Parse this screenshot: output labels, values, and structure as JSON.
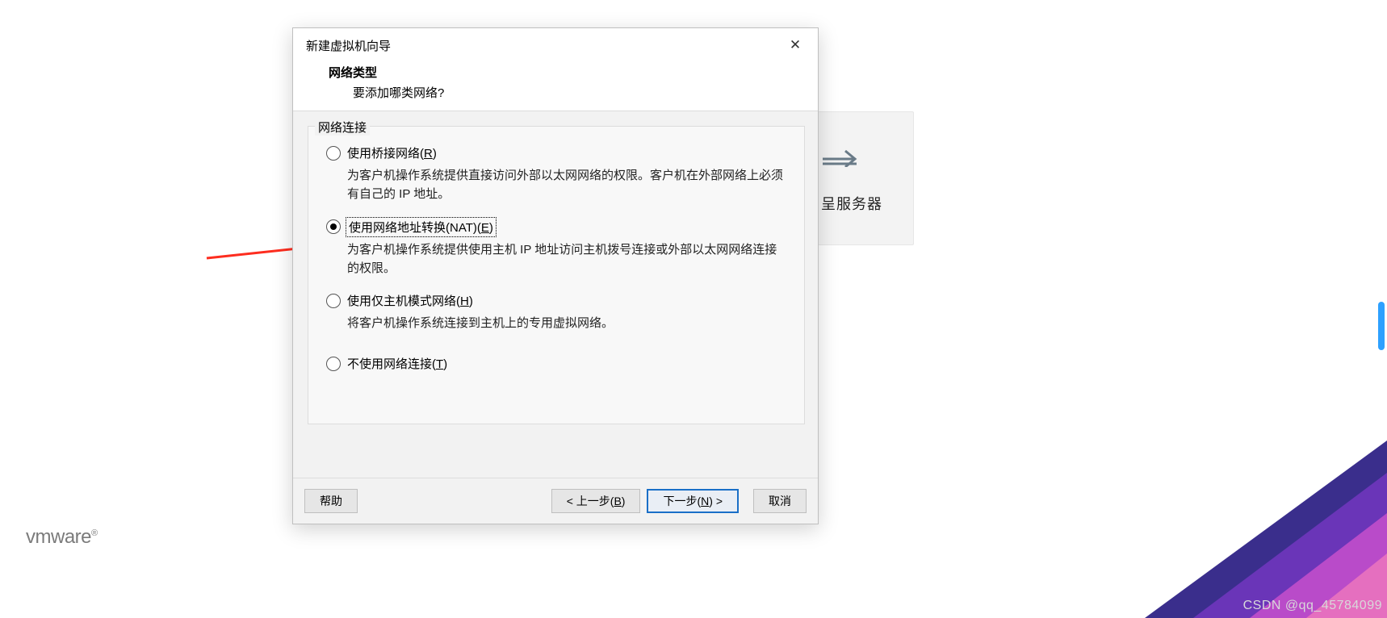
{
  "dialog": {
    "title": "新建虚拟机向导",
    "heading": "网络类型",
    "subheading": "要添加哪类网络?",
    "groupLabel": "网络连接",
    "options": {
      "bridged": {
        "label_pre": "使用桥接网络(",
        "mn": "R",
        "label_post": ")",
        "desc": "为客户机操作系统提供直接访问外部以太网网络的权限。客户机在外部网络上必须有自己的 IP 地址。",
        "checked": false
      },
      "nat": {
        "label_pre": "使用网络地址转换(NAT)(",
        "mn": "E",
        "label_post": ")",
        "desc": "为客户机操作系统提供使用主机 IP 地址访问主机拨号连接或外部以太网网络连接的权限。",
        "checked": true
      },
      "hostonly": {
        "label_pre": "使用仅主机模式网络(",
        "mn": "H",
        "label_post": ")",
        "desc": "将客户机操作系统连接到主机上的专用虚拟网络。",
        "checked": false
      },
      "none": {
        "label_pre": "不使用网络连接(",
        "mn": "T",
        "label_post": ")",
        "desc": "",
        "checked": false
      }
    },
    "buttons": {
      "help": "帮助",
      "back_pre": "< 上一步(",
      "back_mn": "B",
      "back_post": ")",
      "next_pre": "下一步(",
      "next_mn": "N",
      "next_post": ") >",
      "cancel": "取消"
    }
  },
  "background": {
    "card_label": "呈服务器"
  },
  "branding": {
    "logo": "vmware"
  },
  "watermark": "CSDN @qq_45784099",
  "colors": {
    "dialog_bg": "#f2f2f2",
    "primary_border": "#1a6fc7",
    "arrow": "#fd2d1f"
  }
}
